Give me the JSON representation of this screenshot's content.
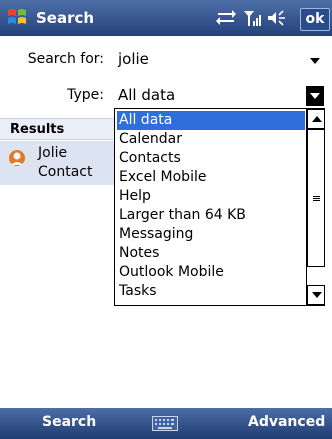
{
  "title_bar": {
    "title": "Search",
    "ok_label": "ok"
  },
  "form": {
    "search_label": "Search for:",
    "search_value": "jolie",
    "type_label": "Type:",
    "type_value": "All data"
  },
  "results": {
    "header": "Results",
    "items": [
      {
        "name": "Jolie",
        "type": "Contact"
      }
    ]
  },
  "dropdown": {
    "selected_index": 0,
    "options": [
      "All data",
      "Calendar",
      "Contacts",
      "Excel Mobile",
      "Help",
      "Larger than 64 KB",
      "Messaging",
      "Notes",
      "Outlook Mobile",
      "Tasks"
    ]
  },
  "softkeys": {
    "left": "Search",
    "right": "Advanced"
  },
  "colors": {
    "titlebar": "#23417a",
    "selection": "#2f6fdc",
    "results_bg": "#dde4f1"
  }
}
